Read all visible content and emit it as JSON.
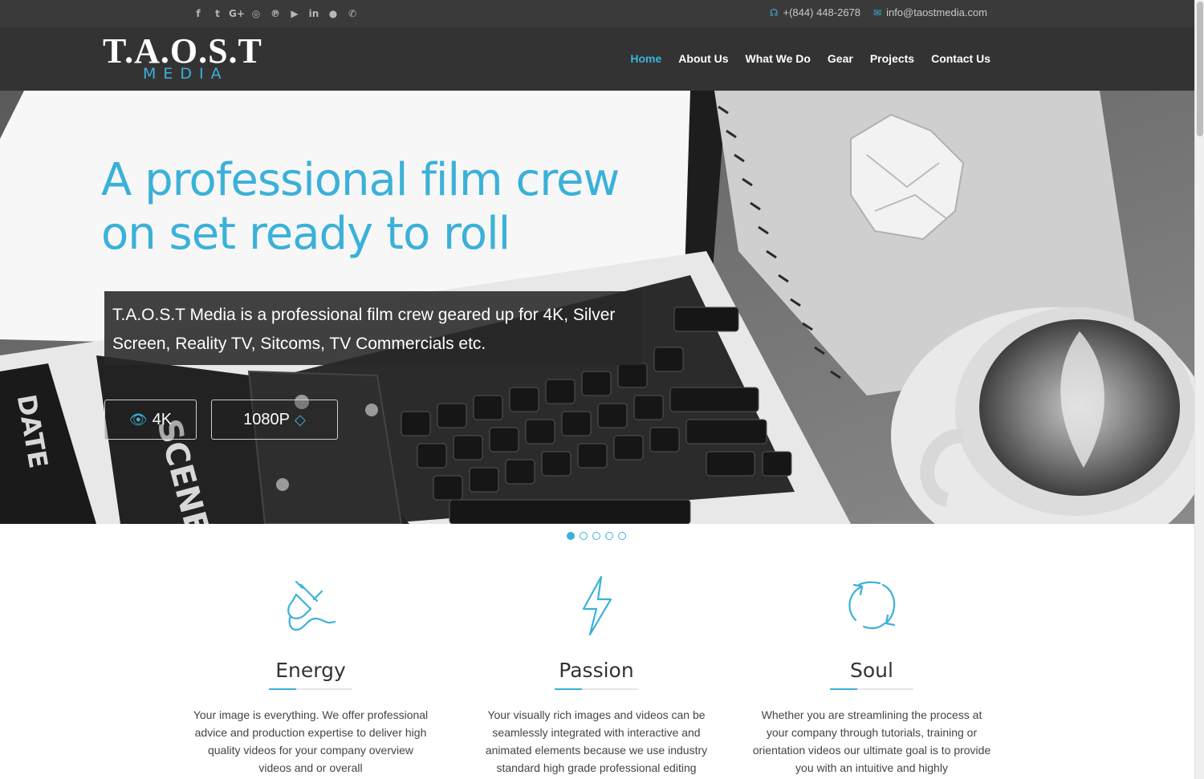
{
  "topbar": {
    "social_icons": [
      "facebook-icon",
      "twitter-icon",
      "google-plus-icon",
      "instagram-icon",
      "pinterest-icon",
      "youtube-icon",
      "linkedin-icon",
      "flickr-icon",
      "whatsapp-icon"
    ],
    "phone": "+(844) 448-2678",
    "email": "info@taostmedia.com"
  },
  "logo": {
    "top": "T.A.O.S.T",
    "bottom": "MEDIA"
  },
  "nav": {
    "items": [
      "Home",
      "About Us",
      "What We Do",
      "Gear",
      "Projects",
      "Contact Us"
    ],
    "active": "Home"
  },
  "hero": {
    "title": "A professional film crew on set ready to roll",
    "description": "T.A.O.S.T Media is a professional film crew geared up for 4K, Silver Screen, Reality TV, Sitcoms, TV Commercials etc.",
    "button_4k": "4K",
    "button_1080": "1080P",
    "slides": 5,
    "active_slide": 1
  },
  "features": [
    {
      "icon": "plug-icon",
      "title": "Energy",
      "text": "Your image is everything. We offer professional advice and production expertise to deliver high quality videos for your company overview videos and or overall"
    },
    {
      "icon": "lightning-icon",
      "title": "Passion",
      "text": "Your visually rich images and videos can be seamlessly integrated with interactive and animated elements because we use industry standard high grade professional editing"
    },
    {
      "icon": "refresh-icon",
      "title": "Soul",
      "text": "Whether you are streamlining the process at your company through tutorials, training or orientation videos our ultimate goal is to provide you with an intuitive and highly"
    }
  ],
  "colors": {
    "accent": "#3bb1d9",
    "topbar": "#3a3a3a",
    "header": "#333333"
  }
}
